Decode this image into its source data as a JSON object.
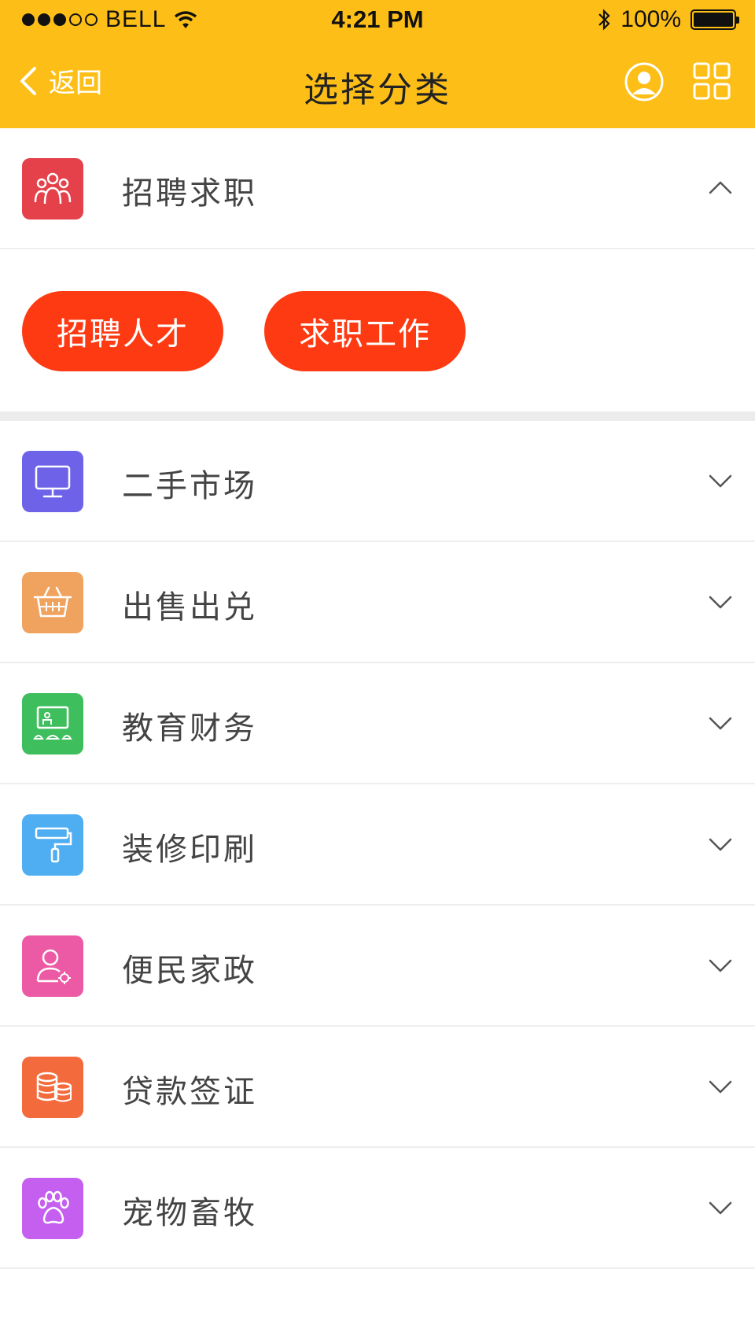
{
  "status_bar": {
    "carrier": "BELL",
    "time": "4:21 PM",
    "battery": "100%",
    "signal_filled": 3,
    "signal_total": 5
  },
  "nav": {
    "back_label": "返回",
    "title": "选择分类",
    "bg_color": "#FDBF17"
  },
  "expanded": {
    "label": "招聘求职",
    "icon": "people-icon",
    "icon_color": "#E5414A",
    "options": [
      "招聘人才",
      "求职工作"
    ],
    "option_color": "#FE3A12"
  },
  "categories": [
    {
      "label": "二手市场",
      "icon": "monitor-icon",
      "color": "#6E63E8"
    },
    {
      "label": "出售出兑",
      "icon": "basket-icon",
      "color": "#F0A35F"
    },
    {
      "label": "教育财务",
      "icon": "classroom-icon",
      "color": "#3FBE5E"
    },
    {
      "label": "装修印刷",
      "icon": "paint-roller-icon",
      "color": "#4FAEF2"
    },
    {
      "label": "便民家政",
      "icon": "person-icon",
      "color": "#EC5AA5"
    },
    {
      "label": "贷款签证",
      "icon": "coins-icon",
      "color": "#F36B3D"
    },
    {
      "label": "宠物畜牧",
      "icon": "paw-icon",
      "color": "#C45FF0"
    }
  ]
}
